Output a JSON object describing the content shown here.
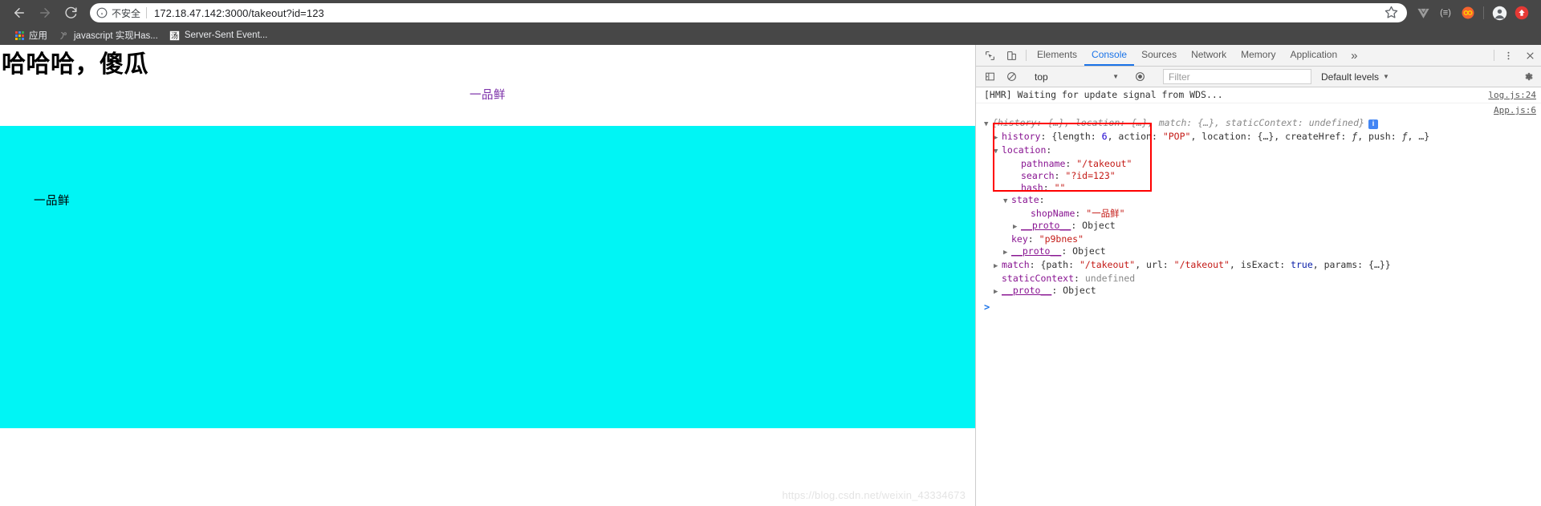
{
  "browser": {
    "nav": {
      "back": "back-arrow",
      "forward": "forward-arrow",
      "reload": "reload"
    },
    "omnibox": {
      "security_label": "不安全",
      "url": "172.18.47.142:3000/takeout?id=123",
      "star": "bookmark-star"
    },
    "extensions": [
      "vue-devtools",
      "tampermonkey",
      "infinity",
      "profile",
      "update"
    ],
    "bookmarks": [
      {
        "label": "应用",
        "icon": "apps-grid"
      },
      {
        "label": "javascript 实现Has...",
        "icon": "bookmark-favicon"
      },
      {
        "label": "Server-Sent Event...",
        "icon": "bookmark-favicon"
      }
    ]
  },
  "page": {
    "title": "哈哈哈，傻瓜",
    "shop_link": "一品鲜",
    "cyan_label": "一品鲜",
    "cyan_color": "#00f5f5",
    "link_color": "#7b2fa8"
  },
  "devtools": {
    "tabs": [
      {
        "label": "Elements",
        "active": false
      },
      {
        "label": "Console",
        "active": true
      },
      {
        "label": "Sources",
        "active": false
      },
      {
        "label": "Network",
        "active": false
      },
      {
        "label": "Memory",
        "active": false
      },
      {
        "label": "Application",
        "active": false
      }
    ],
    "more_tabs": "»",
    "menu_icon": "kebab-menu",
    "close_icon": "close",
    "toolbar": {
      "context": "top",
      "filter_placeholder": "Filter",
      "levels": "Default levels",
      "settings_icon": "gear-icon",
      "clear_icon": "clear-console-icon",
      "sidebar_icon": "console-sidebar-icon",
      "eye_icon": "live-expression-icon"
    },
    "console": {
      "messages": [
        {
          "text": "[HMR] Waiting for update signal from WDS...",
          "source": "log.js:24"
        }
      ],
      "object_source": "App.js:6",
      "lines": [
        {
          "indent": 0,
          "arrow": "down",
          "parts": [
            {
              "t": "{history: ",
              "c": "dim-ital"
            },
            {
              "t": "{…}",
              "c": "dim-ital"
            },
            {
              "t": ", location: ",
              "c": "dim-ital"
            },
            {
              "t": "{…}",
              "c": "dim-ital"
            },
            {
              "t": ", match: ",
              "c": "dim-ital"
            },
            {
              "t": "{…}",
              "c": "dim-ital"
            },
            {
              "t": ", staticContext: ",
              "c": "dim-ital"
            },
            {
              "t": "undefined",
              "c": "dim-ital"
            },
            {
              "t": "}",
              "c": "dim-ital"
            }
          ],
          "badge": "i"
        },
        {
          "indent": 1,
          "arrow": "right",
          "parts": [
            {
              "t": "history",
              "c": "key"
            },
            {
              "t": ": {length: ",
              "c": "plain"
            },
            {
              "t": "6",
              "c": "num"
            },
            {
              "t": ", action: ",
              "c": "plain"
            },
            {
              "t": "\"POP\"",
              "c": "str"
            },
            {
              "t": ", location: {…}, createHref: ",
              "c": "plain"
            },
            {
              "t": "ƒ",
              "c": "ital-plain"
            },
            {
              "t": ", push: ",
              "c": "plain"
            },
            {
              "t": "ƒ",
              "c": "ital-plain"
            },
            {
              "t": ", …}",
              "c": "plain"
            }
          ]
        },
        {
          "indent": 1,
          "arrow": "down",
          "parts": [
            {
              "t": "location",
              "c": "key"
            },
            {
              "t": ":",
              "c": "plain"
            }
          ]
        },
        {
          "indent": 3,
          "arrow": "none",
          "parts": [
            {
              "t": "pathname",
              "c": "key"
            },
            {
              "t": ": ",
              "c": "plain"
            },
            {
              "t": "\"/takeout\"",
              "c": "str"
            }
          ]
        },
        {
          "indent": 3,
          "arrow": "none",
          "parts": [
            {
              "t": "search",
              "c": "key"
            },
            {
              "t": ": ",
              "c": "plain"
            },
            {
              "t": "\"?id=123\"",
              "c": "str"
            }
          ]
        },
        {
          "indent": 3,
          "arrow": "none",
          "parts": [
            {
              "t": "hash",
              "c": "key"
            },
            {
              "t": ": ",
              "c": "plain"
            },
            {
              "t": "\"\"",
              "c": "str"
            }
          ]
        },
        {
          "indent": 2,
          "arrow": "down",
          "parts": [
            {
              "t": "state",
              "c": "key"
            },
            {
              "t": ":",
              "c": "plain"
            }
          ]
        },
        {
          "indent": 4,
          "arrow": "none",
          "parts": [
            {
              "t": "shopName",
              "c": "key"
            },
            {
              "t": ": ",
              "c": "plain"
            },
            {
              "t": "\"一品鲜\"",
              "c": "str"
            }
          ]
        },
        {
          "indent": 3,
          "arrow": "right",
          "parts": [
            {
              "t": "__proto__",
              "c": "proto-u"
            },
            {
              "t": ": Object",
              "c": "plain"
            }
          ]
        },
        {
          "indent": 2,
          "arrow": "none",
          "parts": [
            {
              "t": "key",
              "c": "key"
            },
            {
              "t": ": ",
              "c": "plain"
            },
            {
              "t": "\"p9bnes\"",
              "c": "str"
            }
          ]
        },
        {
          "indent": 2,
          "arrow": "right",
          "parts": [
            {
              "t": "__proto__",
              "c": "proto-u"
            },
            {
              "t": ": Object",
              "c": "plain"
            }
          ]
        },
        {
          "indent": 1,
          "arrow": "right",
          "parts": [
            {
              "t": "match",
              "c": "key"
            },
            {
              "t": ": {path: ",
              "c": "plain"
            },
            {
              "t": "\"/takeout\"",
              "c": "str"
            },
            {
              "t": ", url: ",
              "c": "plain"
            },
            {
              "t": "\"/takeout\"",
              "c": "str"
            },
            {
              "t": ", isExact: ",
              "c": "plain"
            },
            {
              "t": "true",
              "c": "bool"
            },
            {
              "t": ", params: {…}}",
              "c": "plain"
            }
          ]
        },
        {
          "indent": 1,
          "arrow": "none",
          "parts": [
            {
              "t": "staticContext",
              "c": "key"
            },
            {
              "t": ": ",
              "c": "plain"
            },
            {
              "t": "undefined",
              "c": "undef"
            }
          ]
        },
        {
          "indent": 1,
          "arrow": "right",
          "parts": [
            {
              "t": "__proto__",
              "c": "proto-u"
            },
            {
              "t": ": Object",
              "c": "plain"
            }
          ]
        }
      ],
      "prompt": ">"
    }
  },
  "watermark": "https://blog.csdn.net/weixin_43334673"
}
